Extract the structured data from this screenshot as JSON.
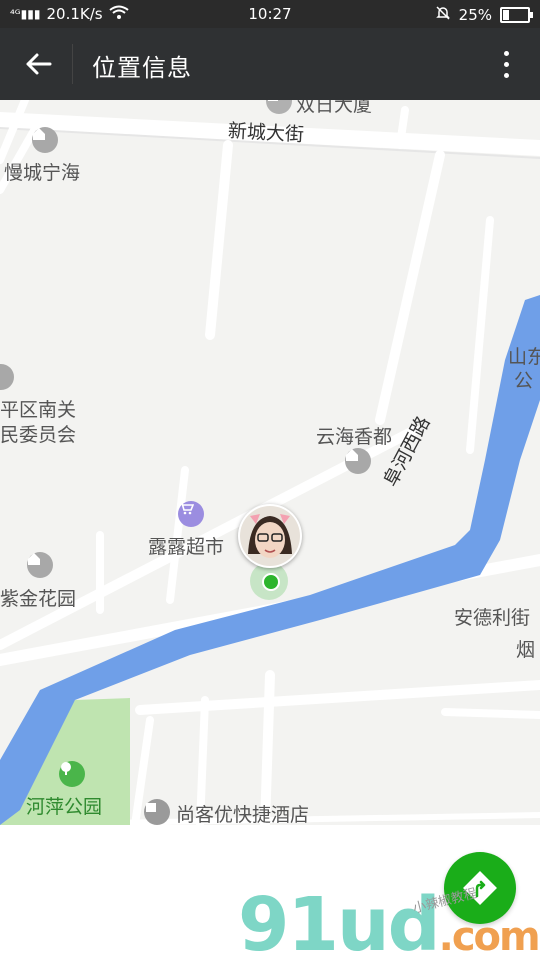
{
  "status_bar": {
    "network": "20.1K/s",
    "time": "10:27",
    "battery": "25%",
    "battery_level": 0.25
  },
  "header": {
    "title": "位置信息"
  },
  "map": {
    "labels": {
      "shuangri_building": "双日大厦",
      "xincheng_street": "新城大街",
      "mancheng_ninghai": "慢城宁海",
      "shandong": "山东",
      "gong": "公",
      "pingqu_nanguan": "平区南关",
      "minweiyuanhui": "民委员会",
      "yunhai_xiangdu": "云海香都",
      "fuhe_west_road": "阜河西路",
      "lulu_supermarket": "露露超市",
      "zijin_garden": "紫金花园",
      "ande_li_street": "安德利街",
      "yan": "烟",
      "heping_park": "河萍公园",
      "shangke_hotel": "尚客优快捷酒店"
    },
    "colors": {
      "land": "#f3f3f1",
      "road": "#ffffff",
      "water": "#6f9fe8",
      "park": "#bfe4b0"
    }
  },
  "watermark": {
    "main": "91ud",
    "tld": ".com",
    "sub": "小辣椒教程"
  }
}
